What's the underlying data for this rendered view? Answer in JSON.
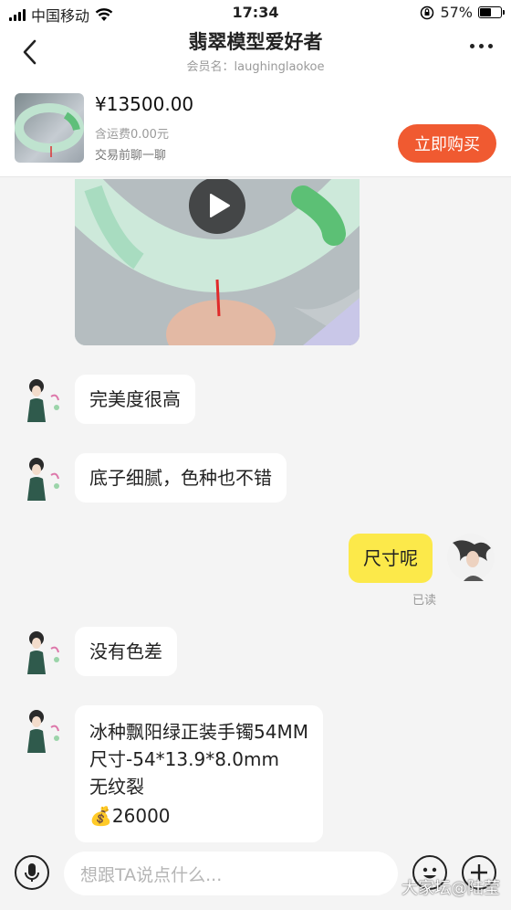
{
  "status_bar": {
    "carrier": "中国移动",
    "time": "17:34",
    "battery_percent": "57%",
    "battery_level": 0.57
  },
  "header": {
    "title": "翡翠模型爱好者",
    "member_label": "会员名：laughinglaokoe"
  },
  "product": {
    "price": "¥13500.00",
    "shipping": "含运费0.00元",
    "chat_note": "交易前聊一聊",
    "buy_label": "立即购买"
  },
  "messages": [
    {
      "text": "完美度很高"
    },
    {
      "text": "底子细腻，色种也不错"
    },
    {
      "text": "尺寸呢",
      "status": "已读"
    },
    {
      "text": "没有色差"
    },
    {
      "lines": [
        "冰种飘阳绿正装手镯54MM",
        "尺寸-54*13.9*8.0mm",
        "无纹裂",
        "💰26000"
      ]
    }
  ],
  "input": {
    "placeholder": "想跟TA说点什么..."
  },
  "watermark": "大家坛@陆莹"
}
